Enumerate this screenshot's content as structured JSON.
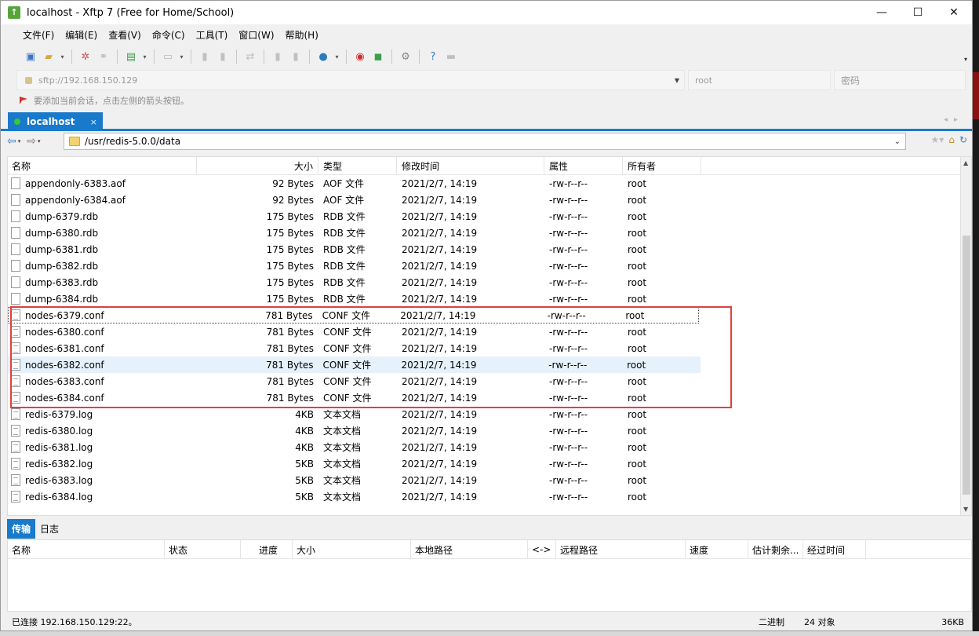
{
  "window": {
    "title": "localhost - Xftp 7 (Free for Home/School)",
    "controls": {
      "minimize": "—",
      "maximize": "☐",
      "close": "✕"
    }
  },
  "menu": [
    "文件(F)",
    "编辑(E)",
    "查看(V)",
    "命令(C)",
    "工具(T)",
    "窗口(W)",
    "帮助(H)"
  ],
  "address": {
    "host": "sftp://192.168.150.129",
    "user": "root",
    "password_placeholder": "密码"
  },
  "hint": "要添加当前会话，点击左侧的箭头按钮。",
  "session_tab": {
    "label": "localhost",
    "close": "×"
  },
  "path": "/usr/redis-5.0.0/data",
  "columns": {
    "name": "名称",
    "size": "大小",
    "type": "类型",
    "modified": "修改时间",
    "attributes": "属性",
    "owner": "所有者"
  },
  "files": [
    {
      "name": "appendonly-6383.aof",
      "size": "92 Bytes",
      "type": "AOF 文件",
      "modified": "2021/2/7, 14:19",
      "attr": "-rw-r--r--",
      "owner": "root"
    },
    {
      "name": "appendonly-6384.aof",
      "size": "92 Bytes",
      "type": "AOF 文件",
      "modified": "2021/2/7, 14:19",
      "attr": "-rw-r--r--",
      "owner": "root"
    },
    {
      "name": "dump-6379.rdb",
      "size": "175 Bytes",
      "type": "RDB 文件",
      "modified": "2021/2/7, 14:19",
      "attr": "-rw-r--r--",
      "owner": "root"
    },
    {
      "name": "dump-6380.rdb",
      "size": "175 Bytes",
      "type": "RDB 文件",
      "modified": "2021/2/7, 14:19",
      "attr": "-rw-r--r--",
      "owner": "root"
    },
    {
      "name": "dump-6381.rdb",
      "size": "175 Bytes",
      "type": "RDB 文件",
      "modified": "2021/2/7, 14:19",
      "attr": "-rw-r--r--",
      "owner": "root"
    },
    {
      "name": "dump-6382.rdb",
      "size": "175 Bytes",
      "type": "RDB 文件",
      "modified": "2021/2/7, 14:19",
      "attr": "-rw-r--r--",
      "owner": "root"
    },
    {
      "name": "dump-6383.rdb",
      "size": "175 Bytes",
      "type": "RDB 文件",
      "modified": "2021/2/7, 14:19",
      "attr": "-rw-r--r--",
      "owner": "root"
    },
    {
      "name": "dump-6384.rdb",
      "size": "175 Bytes",
      "type": "RDB 文件",
      "modified": "2021/2/7, 14:19",
      "attr": "-rw-r--r--",
      "owner": "root"
    },
    {
      "name": "nodes-6379.conf",
      "size": "781 Bytes",
      "type": "CONF 文件",
      "modified": "2021/2/7, 14:19",
      "attr": "-rw-r--r--",
      "owner": "root"
    },
    {
      "name": "nodes-6380.conf",
      "size": "781 Bytes",
      "type": "CONF 文件",
      "modified": "2021/2/7, 14:19",
      "attr": "-rw-r--r--",
      "owner": "root"
    },
    {
      "name": "nodes-6381.conf",
      "size": "781 Bytes",
      "type": "CONF 文件",
      "modified": "2021/2/7, 14:19",
      "attr": "-rw-r--r--",
      "owner": "root"
    },
    {
      "name": "nodes-6382.conf",
      "size": "781 Bytes",
      "type": "CONF 文件",
      "modified": "2021/2/7, 14:19",
      "attr": "-rw-r--r--",
      "owner": "root"
    },
    {
      "name": "nodes-6383.conf",
      "size": "781 Bytes",
      "type": "CONF 文件",
      "modified": "2021/2/7, 14:19",
      "attr": "-rw-r--r--",
      "owner": "root"
    },
    {
      "name": "nodes-6384.conf",
      "size": "781 Bytes",
      "type": "CONF 文件",
      "modified": "2021/2/7, 14:19",
      "attr": "-rw-r--r--",
      "owner": "root"
    },
    {
      "name": "redis-6379.log",
      "size": "4KB",
      "type": "文本文档",
      "modified": "2021/2/7, 14:19",
      "attr": "-rw-r--r--",
      "owner": "root"
    },
    {
      "name": "redis-6380.log",
      "size": "4KB",
      "type": "文本文档",
      "modified": "2021/2/7, 14:19",
      "attr": "-rw-r--r--",
      "owner": "root"
    },
    {
      "name": "redis-6381.log",
      "size": "4KB",
      "type": "文本文档",
      "modified": "2021/2/7, 14:19",
      "attr": "-rw-r--r--",
      "owner": "root"
    },
    {
      "name": "redis-6382.log",
      "size": "5KB",
      "type": "文本文档",
      "modified": "2021/2/7, 14:19",
      "attr": "-rw-r--r--",
      "owner": "root"
    },
    {
      "name": "redis-6383.log",
      "size": "5KB",
      "type": "文本文档",
      "modified": "2021/2/7, 14:19",
      "attr": "-rw-r--r--",
      "owner": "root"
    },
    {
      "name": "redis-6384.log",
      "size": "5KB",
      "type": "文本文档",
      "modified": "2021/2/7, 14:19",
      "attr": "-rw-r--r--",
      "owner": "root"
    }
  ],
  "bottom_tabs": [
    "传输",
    "日志"
  ],
  "transfer_columns": [
    "名称",
    "状态",
    "进度",
    "大小",
    "本地路径",
    "<->",
    "远程路径",
    "速度",
    "估计剩余...",
    "经过时间"
  ],
  "status": {
    "connection": "已连接 192.168.150.129:22。",
    "mode": "二进制",
    "objects": "24 对象",
    "total_size": "36KB"
  },
  "colors": {
    "accent": "#1979ca",
    "highlight_box": "#e04040",
    "selected_row": "#e5f1fb"
  }
}
